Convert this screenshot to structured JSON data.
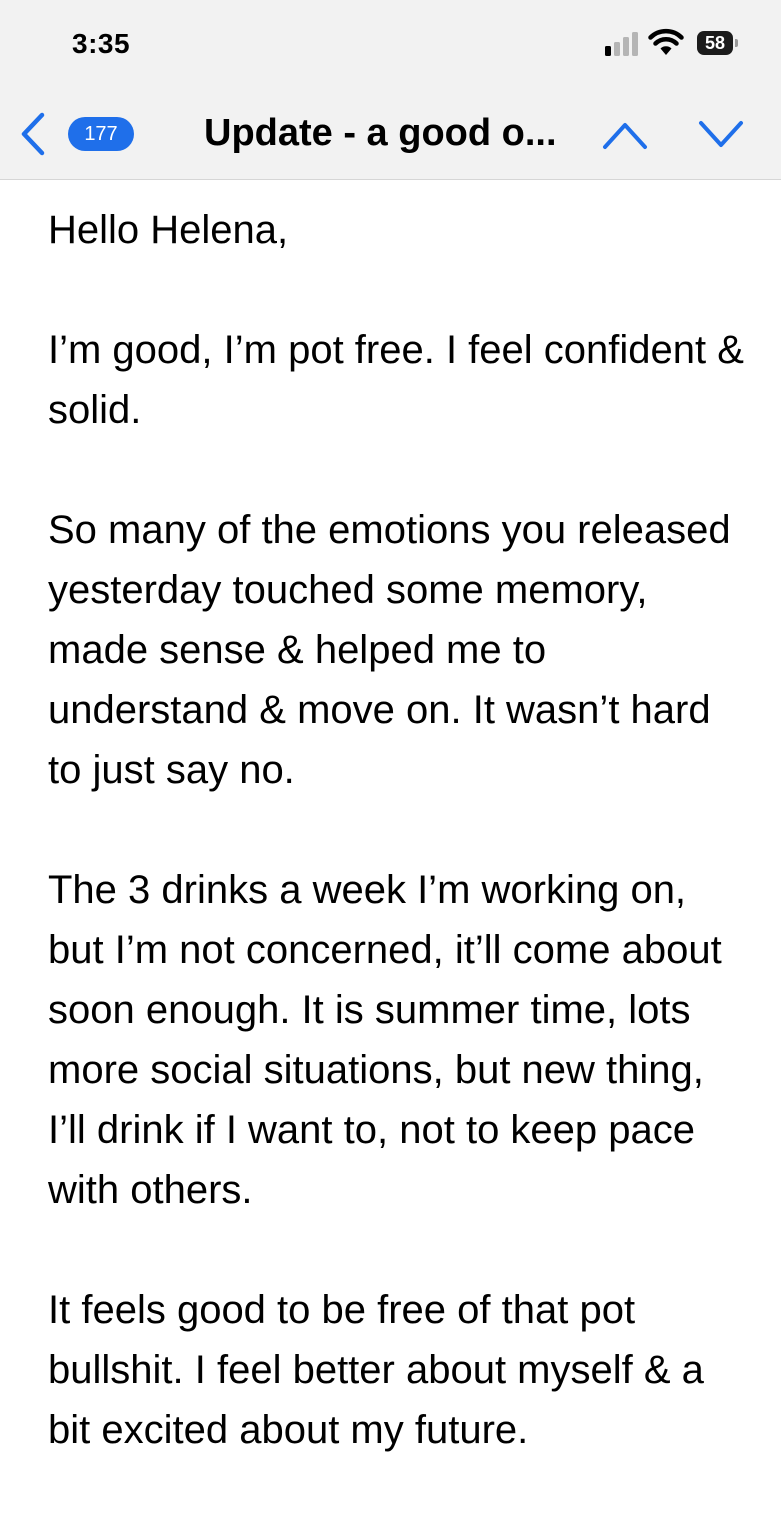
{
  "status_bar": {
    "time": "3:35",
    "battery_level": "58",
    "signal_bars_active": 1,
    "signal_bars_total": 4
  },
  "nav": {
    "unread_count": "177",
    "title": "Update - a good o...",
    "accent_color": "#1f6fea"
  },
  "email": {
    "greeting": "Hello Helena,",
    "paragraphs": [
      "I’m good, I’m pot free. I feel confident & solid.",
      "So many of the emotions you released yesterday touched some memory, made sense & helped me to understand & move on. It wasn’t hard to just say no.",
      "The 3 drinks a week I’m working on, but I’m not concerned, it’ll come about soon enough. It is summer time, lots more social situations, but new thing, I’ll drink if I want to, not to keep pace with others.",
      "It feels good to be free of that pot bullshit. I feel better about myself & a bit excited about my future."
    ]
  },
  "icons": {
    "back": "chevron-left-icon",
    "previous": "chevron-up-icon",
    "next": "chevron-down-icon",
    "signal": "cellular-signal-icon",
    "wifi": "wifi-icon",
    "battery": "battery-icon"
  }
}
